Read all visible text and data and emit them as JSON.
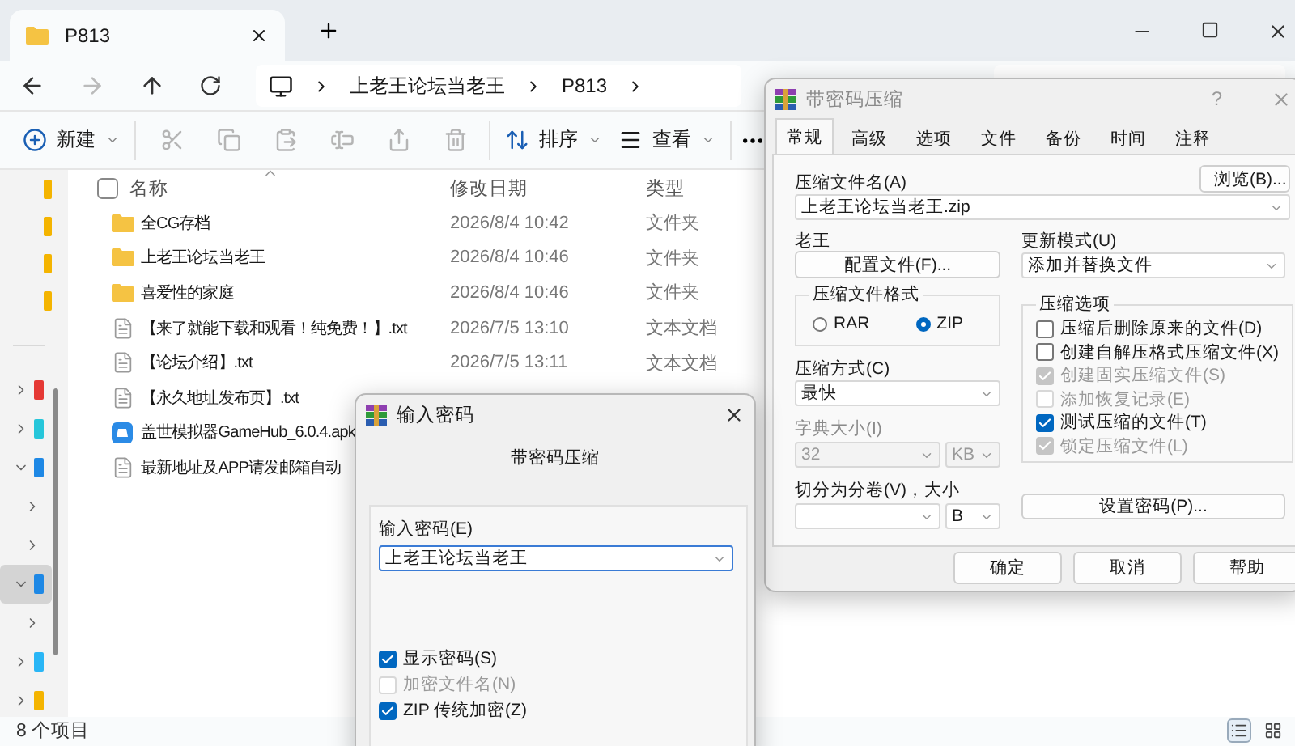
{
  "explorer": {
    "tabs": [
      {
        "title": "P813",
        "selected": true
      }
    ],
    "breadcrumb": [
      "上老王论坛当老王",
      "P813"
    ],
    "select_all": {
      "checked": false
    },
    "toolbar": {
      "new": "新建",
      "sort": "排序",
      "view": "查看"
    },
    "sidebar": {
      "items": [
        {
          "kind": "pinned",
          "color": "#f4b400",
          "selected": false
        },
        {
          "kind": "pinned",
          "color": "#f4b400",
          "selected": false
        },
        {
          "kind": "pinned",
          "color": "#f4b400",
          "selected": false
        },
        {
          "kind": "pinned",
          "color": "#f4b400",
          "selected": false
        },
        {
          "kind": "node",
          "color": "#e53935",
          "expanded": false,
          "selected": false
        },
        {
          "kind": "node",
          "color": "#26c6da",
          "expanded": false,
          "selected": false
        },
        {
          "kind": "node",
          "color": "#1e88e5",
          "expanded": true,
          "selected": false,
          "children": [
            {
              "kind": "node",
              "expanded": false,
              "selected": false
            },
            {
              "kind": "node",
              "expanded": false,
              "selected": false
            }
          ]
        },
        {
          "kind": "node",
          "color": "#1e88e5",
          "expanded": true,
          "selected": true,
          "children": [
            {
              "kind": "node",
              "expanded": false,
              "selected": false
            }
          ]
        },
        {
          "kind": "node",
          "color": "#29b6f6",
          "expanded": false,
          "selected": false
        },
        {
          "kind": "node",
          "color": "#f4b400",
          "expanded": false,
          "selected": false
        }
      ]
    },
    "columns": [
      "名称",
      "修改日期",
      "类型"
    ],
    "rows": [
      {
        "kind": "folder",
        "name": "全CG存档",
        "modified": "2026/8/4 10:42",
        "type": "文件夹"
      },
      {
        "kind": "folder",
        "name": "上老王论坛当老王",
        "modified": "2026/8/4 10:46",
        "type": "文件夹"
      },
      {
        "kind": "folder",
        "name": "喜爱性的家庭",
        "modified": "2026/8/4 10:46",
        "type": "文件夹"
      },
      {
        "kind": "text",
        "name": "【来了就能下载和观看！纯免费！】.txt",
        "modified": "2026/7/5 13:10",
        "type": "文本文档"
      },
      {
        "kind": "text",
        "name": "【论坛介绍】.txt",
        "modified": "2026/7/5 13:11",
        "type": "文本文档"
      },
      {
        "kind": "text",
        "name": "【永久地址发布页】.txt"
      },
      {
        "kind": "app",
        "name": "盖世模拟器GameHub_6.0.4.apk"
      },
      {
        "kind": "text",
        "name": "最新地址及APP请发邮箱自动"
      }
    ],
    "status": "8 个项目",
    "view_modes": [
      {
        "kind": "details",
        "selected": true
      },
      {
        "kind": "tiles",
        "selected": false
      }
    ]
  },
  "compress_dialog": {
    "title": "带密码压缩",
    "help": "?",
    "tabs": [
      {
        "label": "常规",
        "selected": true
      },
      {
        "label": "高级",
        "selected": false
      },
      {
        "label": "选项",
        "selected": false
      },
      {
        "label": "文件",
        "selected": false
      },
      {
        "label": "备份",
        "selected": false
      },
      {
        "label": "时间",
        "selected": false
      },
      {
        "label": "注释",
        "selected": false
      }
    ],
    "archive_name": {
      "label": "压缩文件名(A)",
      "value": "上老王论坛当老王.zip"
    },
    "browse": "浏览(B)...",
    "profile": {
      "label": "老王",
      "button": "配置文件(F)..."
    },
    "update_mode": {
      "label": "更新模式(U)",
      "value": "添加并替换文件"
    },
    "format": {
      "title": "压缩文件格式",
      "options": [
        {
          "label": "RAR",
          "selected": false
        },
        {
          "label": "ZIP",
          "selected": true
        }
      ]
    },
    "method": {
      "label": "压缩方式(C)",
      "value": "最快"
    },
    "dictionary": {
      "label": "字典大小(I)",
      "value": "32",
      "unit": "KB",
      "disabled": true
    },
    "split": {
      "label": "切分为分卷(V)，大小",
      "unit": "B"
    },
    "options": {
      "title": "压缩选项",
      "items": [
        {
          "label": "压缩后删除原来的文件(D)",
          "checked": false,
          "disabled": false
        },
        {
          "label": "创建自解压格式压缩文件(X)",
          "checked": false,
          "disabled": false
        },
        {
          "label": "创建固实压缩文件(S)",
          "checked": true,
          "disabled": true
        },
        {
          "label": "添加恢复记录(E)",
          "checked": false,
          "disabled": true
        },
        {
          "label": "测试压缩的文件(T)",
          "checked": true,
          "disabled": false
        },
        {
          "label": "锁定压缩文件(L)",
          "checked": true,
          "disabled": true
        }
      ]
    },
    "set_password": "设置密码(P)...",
    "buttons": [
      "确定",
      "取消",
      "帮助"
    ]
  },
  "password_dialog": {
    "title": "输入密码",
    "subtitle": "带密码压缩",
    "label": "输入密码(E)",
    "value": "上老王论坛当老王",
    "options": [
      {
        "label": "显示密码(S)",
        "checked": true,
        "disabled": false
      },
      {
        "label": "加密文件名(N)",
        "checked": false,
        "disabled": true
      },
      {
        "label": "ZIP 传统加密(Z)",
        "checked": true,
        "disabled": false
      }
    ]
  }
}
